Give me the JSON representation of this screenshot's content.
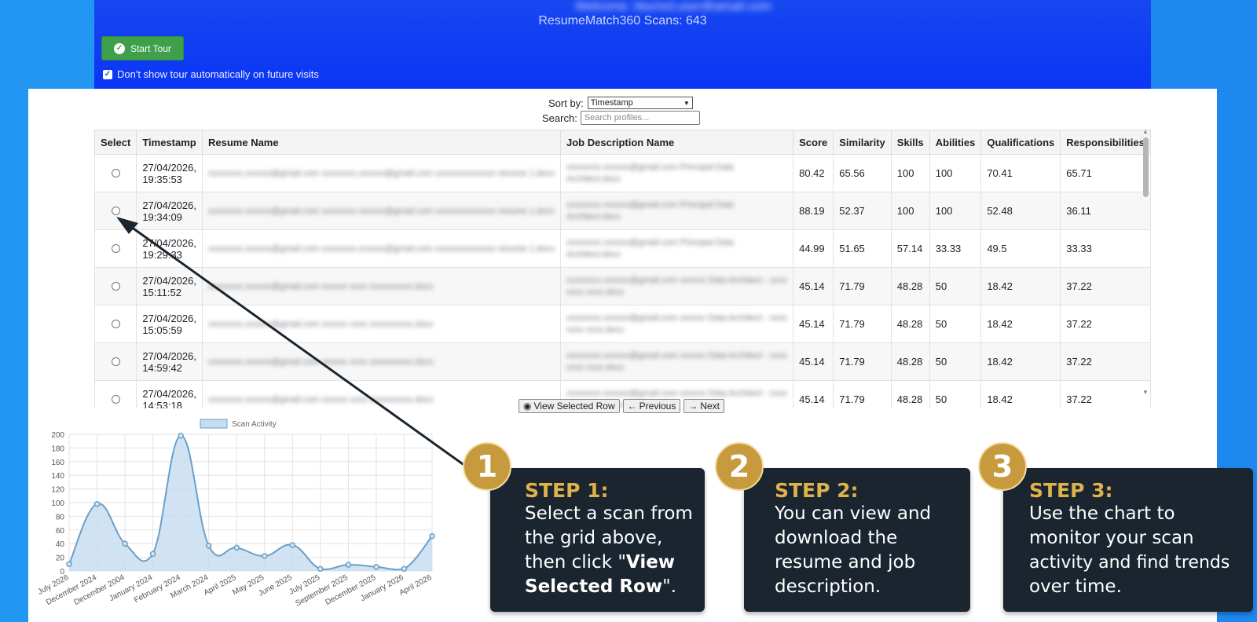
{
  "header": {
    "email_blurred": "Welcome, blurred.user@gmail.com",
    "scan_count_text": "ResumeMatch360 Scans: 643",
    "start_tour_label": "Start Tour",
    "dont_show_label": "Don't show tour automatically on future visits"
  },
  "controls": {
    "sort_label": "Sort by:",
    "sort_value": "Timestamp",
    "search_label": "Search:",
    "search_placeholder": "Search profiles..."
  },
  "table": {
    "columns": [
      "Select",
      "Timestamp",
      "Resume Name",
      "Job Description Name",
      "Score",
      "Similarity",
      "Skills",
      "Abilities",
      "Qualifications",
      "Responsibilities"
    ],
    "rows": [
      {
        "ts1": "27/04/2026,",
        "ts2": "19:35:53",
        "resume": "xxxxxxxx.xxxxxx@gmail.com xxxxxxxx.xxxxxx@gmail.com xxxxxxxxxxxxxx resume 1.docx",
        "jd": "xxxxxxxx.xxxxxx@gmail.com Principal Data Architect.docx",
        "score": "80.42",
        "similarity": "65.56",
        "skills": "100",
        "abilities": "100",
        "qualifications": "70.41",
        "responsibilities": "65.71"
      },
      {
        "ts1": "27/04/2026,",
        "ts2": "19:34:09",
        "resume": "xxxxxxxx.xxxxxx@gmail.com xxxxxxxx.xxxxxx@gmail.com xxxxxxxxxxxxxx resume 1.docx",
        "jd": "xxxxxxxx.xxxxxx@gmail.com Principal Data Architect.docx",
        "score": "88.19",
        "similarity": "52.37",
        "skills": "100",
        "abilities": "100",
        "qualifications": "52.48",
        "responsibilities": "36.11"
      },
      {
        "ts1": "27/04/2026,",
        "ts2": "19:29:33",
        "resume": "xxxxxxxx.xxxxxx@gmail.com xxxxxxxx.xxxxxx@gmail.com xxxxxxxxxxxxxx resume 1.docx",
        "jd": "xxxxxxxx.xxxxxx@gmail.com Principal Data Architect.docx",
        "score": "44.99",
        "similarity": "51.65",
        "skills": "57.14",
        "abilities": "33.33",
        "qualifications": "49.5",
        "responsibilities": "33.33"
      },
      {
        "ts1": "27/04/2026,",
        "ts2": "15:11:52",
        "resume": "xxxxxxxx.xxxxxx@gmail.com xxxxxx xxxx xxxxxxxxxx.docx",
        "jd": "xxxxxxxx.xxxxxx@gmail.com xxxxxx Data Architect - xxxx xxxx xxxx.docx",
        "score": "45.14",
        "similarity": "71.79",
        "skills": "48.28",
        "abilities": "50",
        "qualifications": "18.42",
        "responsibilities": "37.22"
      },
      {
        "ts1": "27/04/2026,",
        "ts2": "15:05:59",
        "resume": "xxxxxxxx.xxxxxx@gmail.com xxxxxx xxxx xxxxxxxxxx.docx",
        "jd": "xxxxxxxx.xxxxxx@gmail.com xxxxxx Data Architect - xxxx xxxx xxxx.docx",
        "score": "45.14",
        "similarity": "71.79",
        "skills": "48.28",
        "abilities": "50",
        "qualifications": "18.42",
        "responsibilities": "37.22"
      },
      {
        "ts1": "27/04/2026,",
        "ts2": "14:59:42",
        "resume": "xxxxxxxx.xxxxxx@gmail.com xxxxxx xxxx xxxxxxxxxx.docx",
        "jd": "xxxxxxxx.xxxxxx@gmail.com xxxxxx Data Architect - xxxx xxxx xxxx.docx",
        "score": "45.14",
        "similarity": "71.79",
        "skills": "48.28",
        "abilities": "50",
        "qualifications": "18.42",
        "responsibilities": "37.22"
      },
      {
        "ts1": "27/04/2026,",
        "ts2": "14:53:18",
        "resume": "xxxxxxxx.xxxxxx@gmail.com xxxxxx xxxx xxxxxxxxxx.docx",
        "jd": "xxxxxxxx.xxxxxx@gmail.com xxxxxx Data Architect - xxxx xxxx xxxx.docx",
        "score": "45.14",
        "similarity": "71.79",
        "skills": "48.28",
        "abilities": "50",
        "qualifications": "18.42",
        "responsibilities": "37.22"
      }
    ]
  },
  "pager": {
    "view_label": "View Selected Row",
    "prev_label": "Previous",
    "next_label": "Next"
  },
  "chart_data": {
    "type": "area",
    "legend": "Scan Activity",
    "categories": [
      "July 2026",
      "December 2024",
      "December 2004",
      "January 2024",
      "February 2024",
      "March 2024",
      "April 2025",
      "May 2025",
      "June 2025",
      "July 2025",
      "September 2025",
      "December 2025",
      "January 2026",
      "April 2026"
    ],
    "values": [
      10,
      98,
      40,
      25,
      198,
      37,
      34,
      22,
      38,
      3,
      9,
      6,
      3,
      51
    ],
    "ylim": [
      0,
      200
    ],
    "yticks": [
      0,
      20,
      40,
      60,
      80,
      100,
      120,
      140,
      160,
      180,
      200
    ],
    "color": "#6a9fc9",
    "fill": "#c6dcef",
    "grid": true
  },
  "steps": [
    {
      "num": "1",
      "title": "STEP 1:",
      "line1": "Select a scan from",
      "line2": "the grid above,",
      "line3a": "then click \"",
      "line3b": "View",
      "line4a": "Selected Row",
      "line4b": "\"."
    },
    {
      "num": "2",
      "title": "STEP 2:",
      "line1": "You can view and",
      "line2": "download the",
      "line3": "resume and job",
      "line4": "description."
    },
    {
      "num": "3",
      "title": "STEP 3:",
      "line1": "Use the chart to",
      "line2": "monitor your scan",
      "line3": "activity and find trends",
      "line4": "over time."
    }
  ],
  "colors": {
    "header": "#0b35f5",
    "accent_green": "#3ea04a",
    "callout_bg": "#1a2530",
    "step_gold": "#e0b24a"
  }
}
